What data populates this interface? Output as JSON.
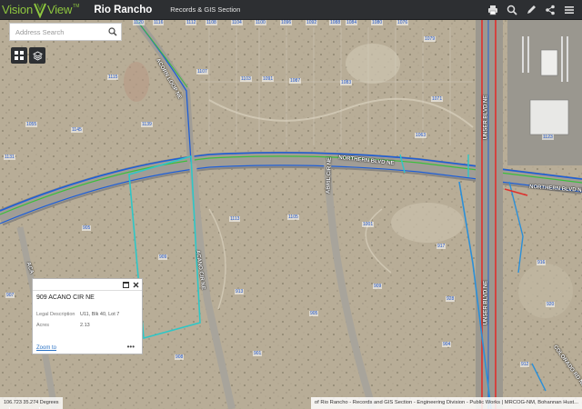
{
  "header": {
    "logo_left": "Vision",
    "logo_right": "View",
    "logo_sup": "TM",
    "city": "Rio Rancho",
    "section": "Records & GIS Section",
    "tools": [
      "print-icon",
      "search-icon",
      "pencil-icon",
      "share-icon",
      "menu-icon"
    ]
  },
  "search": {
    "placeholder": "Address Search"
  },
  "popup": {
    "title": "909 ACANO CIR NE",
    "fields": [
      {
        "label": "Legal Description",
        "value": "U11, Blk 40, Lot 7"
      },
      {
        "label": "Acres",
        "value": "2.13"
      }
    ],
    "zoom_link": "Zoom to",
    "more": "•••"
  },
  "streets": {
    "northern_left": "NORTHERN BLVD NE",
    "northern_right": "NORTHERN BLVD NE",
    "unser_top": "UNSER BLVD NE",
    "unser_bottom": "UNSER BLVD NE",
    "acorn_loop": "ACORN LOOP NE",
    "acano": "ACANO CIR NE",
    "abril": "ABRIL CIR NE",
    "colorado": "COLORADO RD NE",
    "aca": "ACA"
  },
  "parcels": [
    "1120",
    "1116",
    "1112",
    "1108",
    "1104",
    "1100",
    "1096",
    "1092",
    "1088",
    "1084",
    "1080",
    "1076",
    "1072",
    "1115",
    "1107",
    "1103",
    "1091",
    "1087",
    "1083",
    "1079",
    "1071",
    "1063",
    "1055",
    "1145",
    "1139",
    "1131",
    "1123",
    "1113",
    "1105",
    "1001",
    "905",
    "909",
    "917",
    "913",
    "909",
    "905",
    "907",
    "901",
    "908",
    "904",
    "912",
    "916",
    "920",
    "928",
    "1000",
    "1004",
    "1008",
    "989"
  ],
  "footer": {
    "coords": "106.723 35.274 Degrees",
    "attribution": "of Rio Rancho - Records and GIS Section - Engineering Division - Public Works | MRCOG-NM, Bohannan Hust..."
  },
  "colors": {
    "header_bg": "#2d2f32",
    "logo_green": "#8ec63f",
    "road_blue": "#1f5fd6",
    "road_green": "#3cbf3c",
    "parcel_cyan": "#2ec7c7",
    "unser_red": "#e0302d"
  }
}
